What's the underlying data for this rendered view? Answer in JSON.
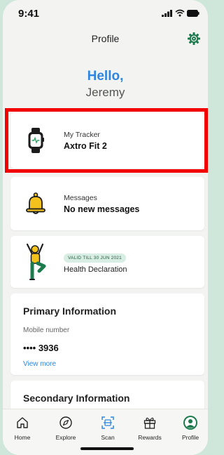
{
  "status_bar": {
    "time": "9:41"
  },
  "header": {
    "title": "Profile"
  },
  "greeting": {
    "hello": "Hello,",
    "name": "Jeremy"
  },
  "cards": {
    "tracker": {
      "subtitle": "My Tracker",
      "title": "Axtro Fit 2"
    },
    "messages": {
      "subtitle": "Messages",
      "title": "No new messages"
    },
    "health": {
      "badge": "VALID TILL 30 JUN 2021",
      "title": "Health Declaration"
    }
  },
  "primary": {
    "title": "Primary Information",
    "mobile_label": "Mobile number",
    "mobile_value": "•••• 3936",
    "view_more": "View more"
  },
  "secondary": {
    "title": "Secondary Information"
  },
  "tabs": [
    {
      "label": "Home",
      "icon": "home-icon"
    },
    {
      "label": "Explore",
      "icon": "compass-icon"
    },
    {
      "label": "Scan",
      "icon": "scan-icon"
    },
    {
      "label": "Rewards",
      "icon": "gift-icon"
    },
    {
      "label": "Profile",
      "icon": "profile-icon"
    }
  ],
  "colors": {
    "accent_blue": "#2f86e0",
    "brand_green": "#1c7a4d",
    "highlight_red": "#f20000",
    "bell_yellow": "#f4c21c"
  }
}
